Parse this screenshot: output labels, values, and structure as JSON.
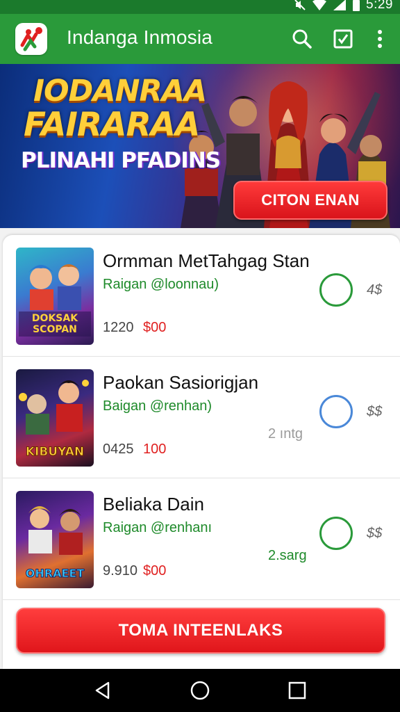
{
  "status_bar": {
    "time": "5:29"
  },
  "app_bar": {
    "title": "Indanga Inmosia"
  },
  "banner": {
    "title_line1": "IODANRAA",
    "title_line2": "FAIRARAA",
    "subtitle": "PLINAHI PFADINS",
    "button_label": "CITON  ENAN"
  },
  "games": [
    {
      "name": "Ormman MetTahgag Stan",
      "sub": "Raigan @loonnau)",
      "code": "1220",
      "price": "$00",
      "players": "",
      "rank": "4$",
      "status_color": "#2a9a3a",
      "thumb_text": "DOKSAK SCOPAN"
    },
    {
      "name": "Paokan Sasiorigjan",
      "sub": "Baigan @renhan)",
      "code": "0425",
      "price": "100",
      "players": "2 ıntg",
      "players_color": "#9a9a9a",
      "rank": "$$",
      "status_color": "#4a88d8",
      "thumb_text": "KIBUYAN"
    },
    {
      "name": "Beliaka Dain",
      "sub": "Raigan @renhanı",
      "code": "9.910",
      "price": "$00",
      "players": "2.sarg",
      "players_color": "#1e8a2a",
      "rank": "$$",
      "status_color": "#2a9a3a",
      "thumb_text": "OHRAEET"
    }
  ],
  "main_button": {
    "label": "TOMA INTEENLAKS"
  },
  "icons": {
    "app_logo": "app-logo-icon",
    "search": "search-icon",
    "checkbox": "checkbox-icon",
    "more": "more-vert-icon",
    "back": "back-icon",
    "home": "home-icon",
    "recents": "recents-icon"
  },
  "colors": {
    "app_bar": "#2a9a3a",
    "status_bar": "#1b7a2c",
    "accent_red": "#e0161b",
    "price_red": "#e02020",
    "sub_green": "#1e8a2a"
  }
}
